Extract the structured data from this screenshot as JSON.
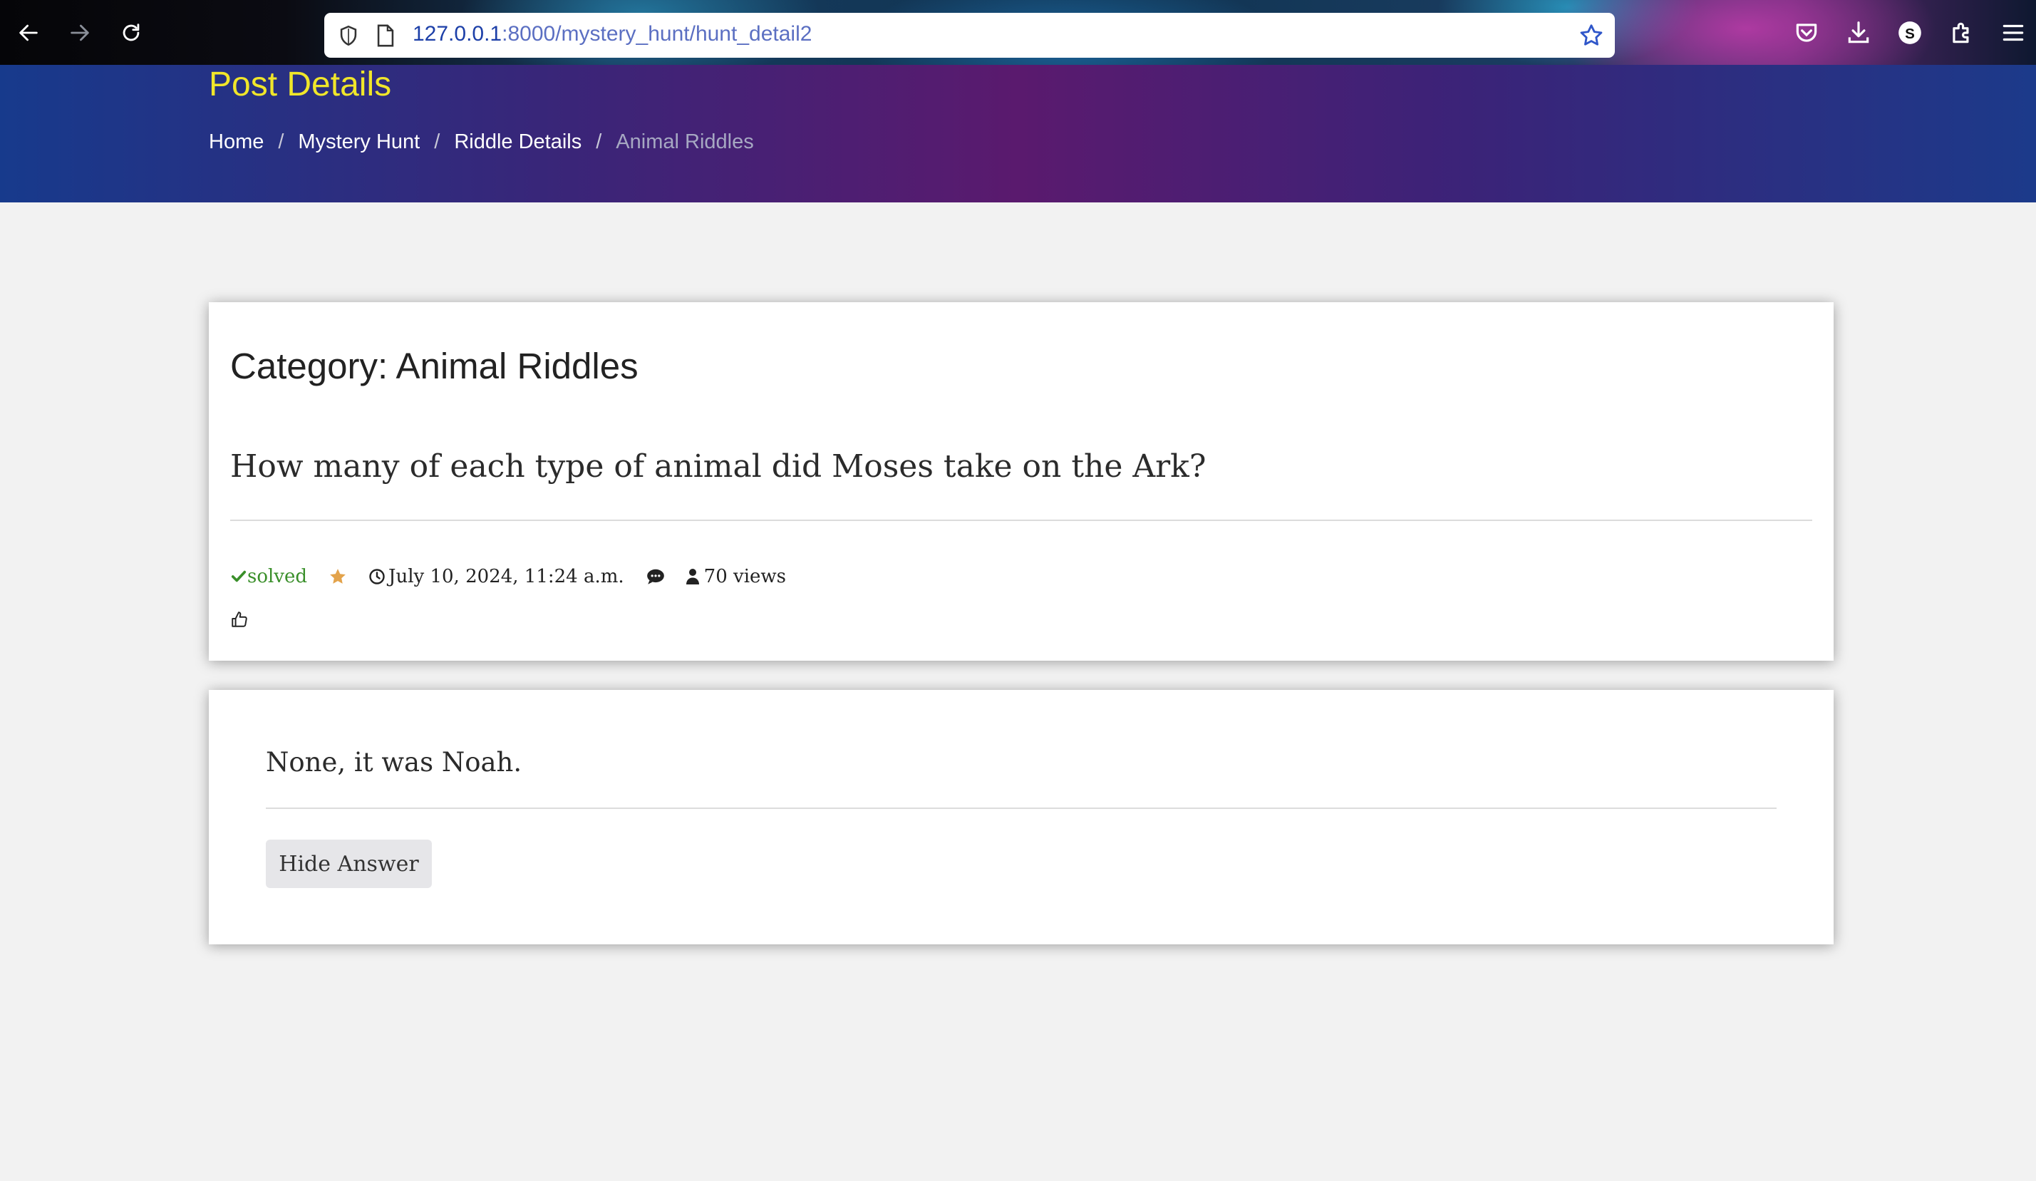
{
  "browser": {
    "url_host": "127.0.0.1",
    "url_path": ":8000/mystery_hunt/hunt_detail2"
  },
  "header": {
    "title": "Post Details",
    "breadcrumb": [
      "Home",
      "Mystery Hunt",
      "Riddle Details",
      "Animal Riddles"
    ],
    "separator": "/"
  },
  "post": {
    "category_title": "Category: Animal Riddles",
    "question": "How many of each type of animal did Moses take on the Ark?",
    "status": "solved",
    "date": "July 10, 2024, 11:24 a.m.",
    "views": "70 views"
  },
  "answer": {
    "text": "None, it was Noah.",
    "button_label": "Hide Answer"
  },
  "colors": {
    "title_yellow": "#f0e62a",
    "solved_green": "#3a8f2a",
    "star_orange": "#e3a34b"
  }
}
